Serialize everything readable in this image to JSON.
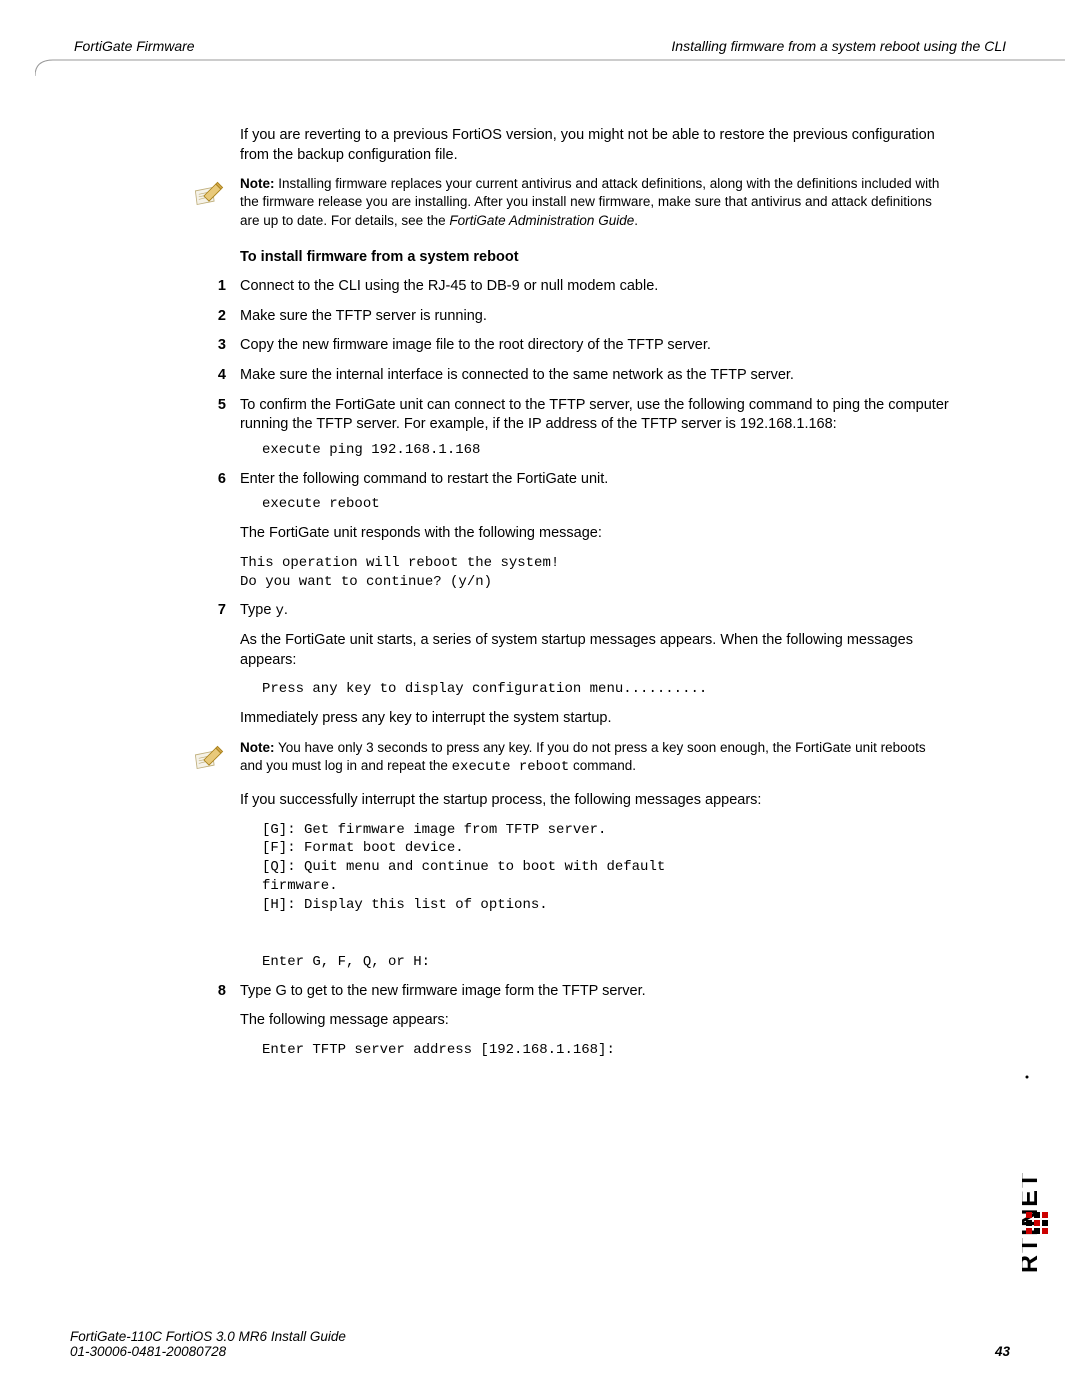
{
  "header": {
    "left": "FortiGate Firmware",
    "right": "Installing firmware from a system reboot using the CLI"
  },
  "intro_para": "If you are reverting to a previous FortiOS version, you might not be able to restore the previous configuration from the backup configuration file.",
  "note1": {
    "label": "Note:",
    "body1": " Installing firmware replaces your current antivirus and attack definitions, along with the definitions included with the firmware release you are installing. After you install new firmware, make sure that antivirus and attack definitions are up to date. For details, see the ",
    "italic": "FortiGate Administration Guide",
    "body2": "."
  },
  "section_heading": "To install firmware from a system reboot",
  "steps": {
    "s1": "Connect to the CLI using the RJ-45 to DB-9 or null modem cable.",
    "s2": "Make sure the TFTP server is running.",
    "s3": "Copy the new firmware image file to the root directory of the TFTP server.",
    "s4": "Make sure the internal interface is connected to the same network as the TFTP server.",
    "s5": "To confirm the FortiGate unit can connect to the TFTP server, use the following command to ping the computer running the TFTP server. For example, if the IP address of the TFTP server is 192.168.1.168:",
    "s5_cmd": "execute ping 192.168.1.168",
    "s6": "Enter the following command to restart the FortiGate unit.",
    "s6_cmd": "execute reboot",
    "s6_after": "The FortiGate unit responds with the following message:",
    "s6_msg": "This operation will reboot the system!\nDo you want to continue? (y/n)",
    "s7_a": "Type ",
    "s7_mono": "y",
    "s7_b": ".",
    "s7_p2": "As the FortiGate unit starts, a series of system startup messages appears. When the following messages appears:",
    "s7_cmd": "Press any key to display configuration menu..........",
    "s7_p3": "Immediately press any key to interrupt the system startup.",
    "s7_note_label": "Note:",
    "s7_note_a": " You have only 3 seconds to press any key. If you do not press a key soon enough, the ",
    "s7_note_fg": "FortiGate",
    "s7_note_b": " unit reboots and you must log in and repeat the ",
    "s7_note_mono": "execute reboot",
    "s7_note_c": " command.",
    "s7_p4": "If you successfully interrupt the startup process, the following messages appears:",
    "s7_menu": "[G]: Get firmware image from TFTP server.\n[F]: Format boot device.\n[Q]: Quit menu and continue to boot with default\nfirmware.\n[H]: Display this list of options.\n\n\nEnter G, F, Q, or H:",
    "s8": "Type G to get to the new firmware image form the TFTP server.",
    "s8_p2": "The following message appears:",
    "s8_cmd": "Enter TFTP server address [192.168.1.168]:"
  },
  "footer": {
    "line1": "FortiGate-110C FortiOS 3.0 MR6 Install Guide",
    "line2": "01-30006-0481-20080728",
    "page": "43"
  },
  "logo_text": "FORTINET"
}
